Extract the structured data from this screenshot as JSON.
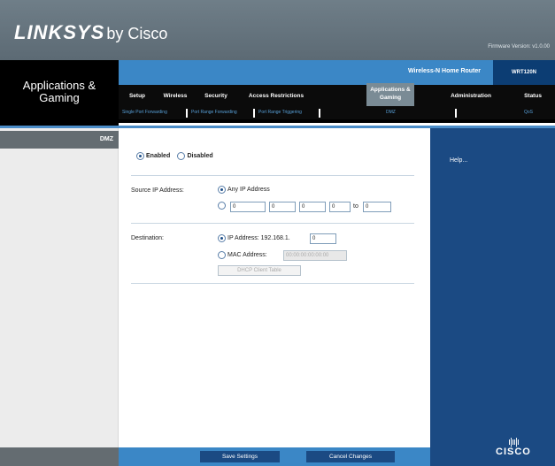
{
  "header": {
    "brand": "LINKSYS",
    "by": "by Cisco",
    "firmware": "Firmware Version: v1.0.00"
  },
  "section_title": "Applications &\nGaming",
  "product_name": "Wireless-N Home Router",
  "model": "WRT120N",
  "tabs": [
    {
      "label": "Setup"
    },
    {
      "label": "Wireless"
    },
    {
      "label": "Security"
    },
    {
      "label": "Access Restrictions"
    },
    {
      "label": "Applications &\nGaming",
      "active": true
    },
    {
      "label": "Administration"
    },
    {
      "label": "Status"
    }
  ],
  "subtabs": [
    {
      "label": "Single Port Forwarding"
    },
    {
      "label": "Port Range Forwarding"
    },
    {
      "label": "Port Range Triggering"
    },
    {
      "label": "DMZ"
    },
    {
      "label": "QoS"
    }
  ],
  "left_label": "DMZ",
  "dmz": {
    "enabled_label": "Enabled",
    "disabled_label": "Disabled",
    "enabled_selected": true,
    "source_label": "Source IP Address:",
    "any_ip_label": "Any IP Address",
    "src_range": [
      "0",
      "0",
      "0",
      "0",
      "0"
    ],
    "to_label": "to",
    "destination_label": "Destination:",
    "ip_address_label": "IP Address: 192.168.1.",
    "ip_last_octet": "0",
    "mac_address_label": "MAC Address:",
    "mac_value": "00:00:00:00:00:00",
    "dhcp_button": "DHCP Client Table"
  },
  "help_link": "Help...",
  "footer": {
    "save": "Save Settings",
    "cancel": "Cancel Changes"
  },
  "cisco_logo": "CISCO"
}
